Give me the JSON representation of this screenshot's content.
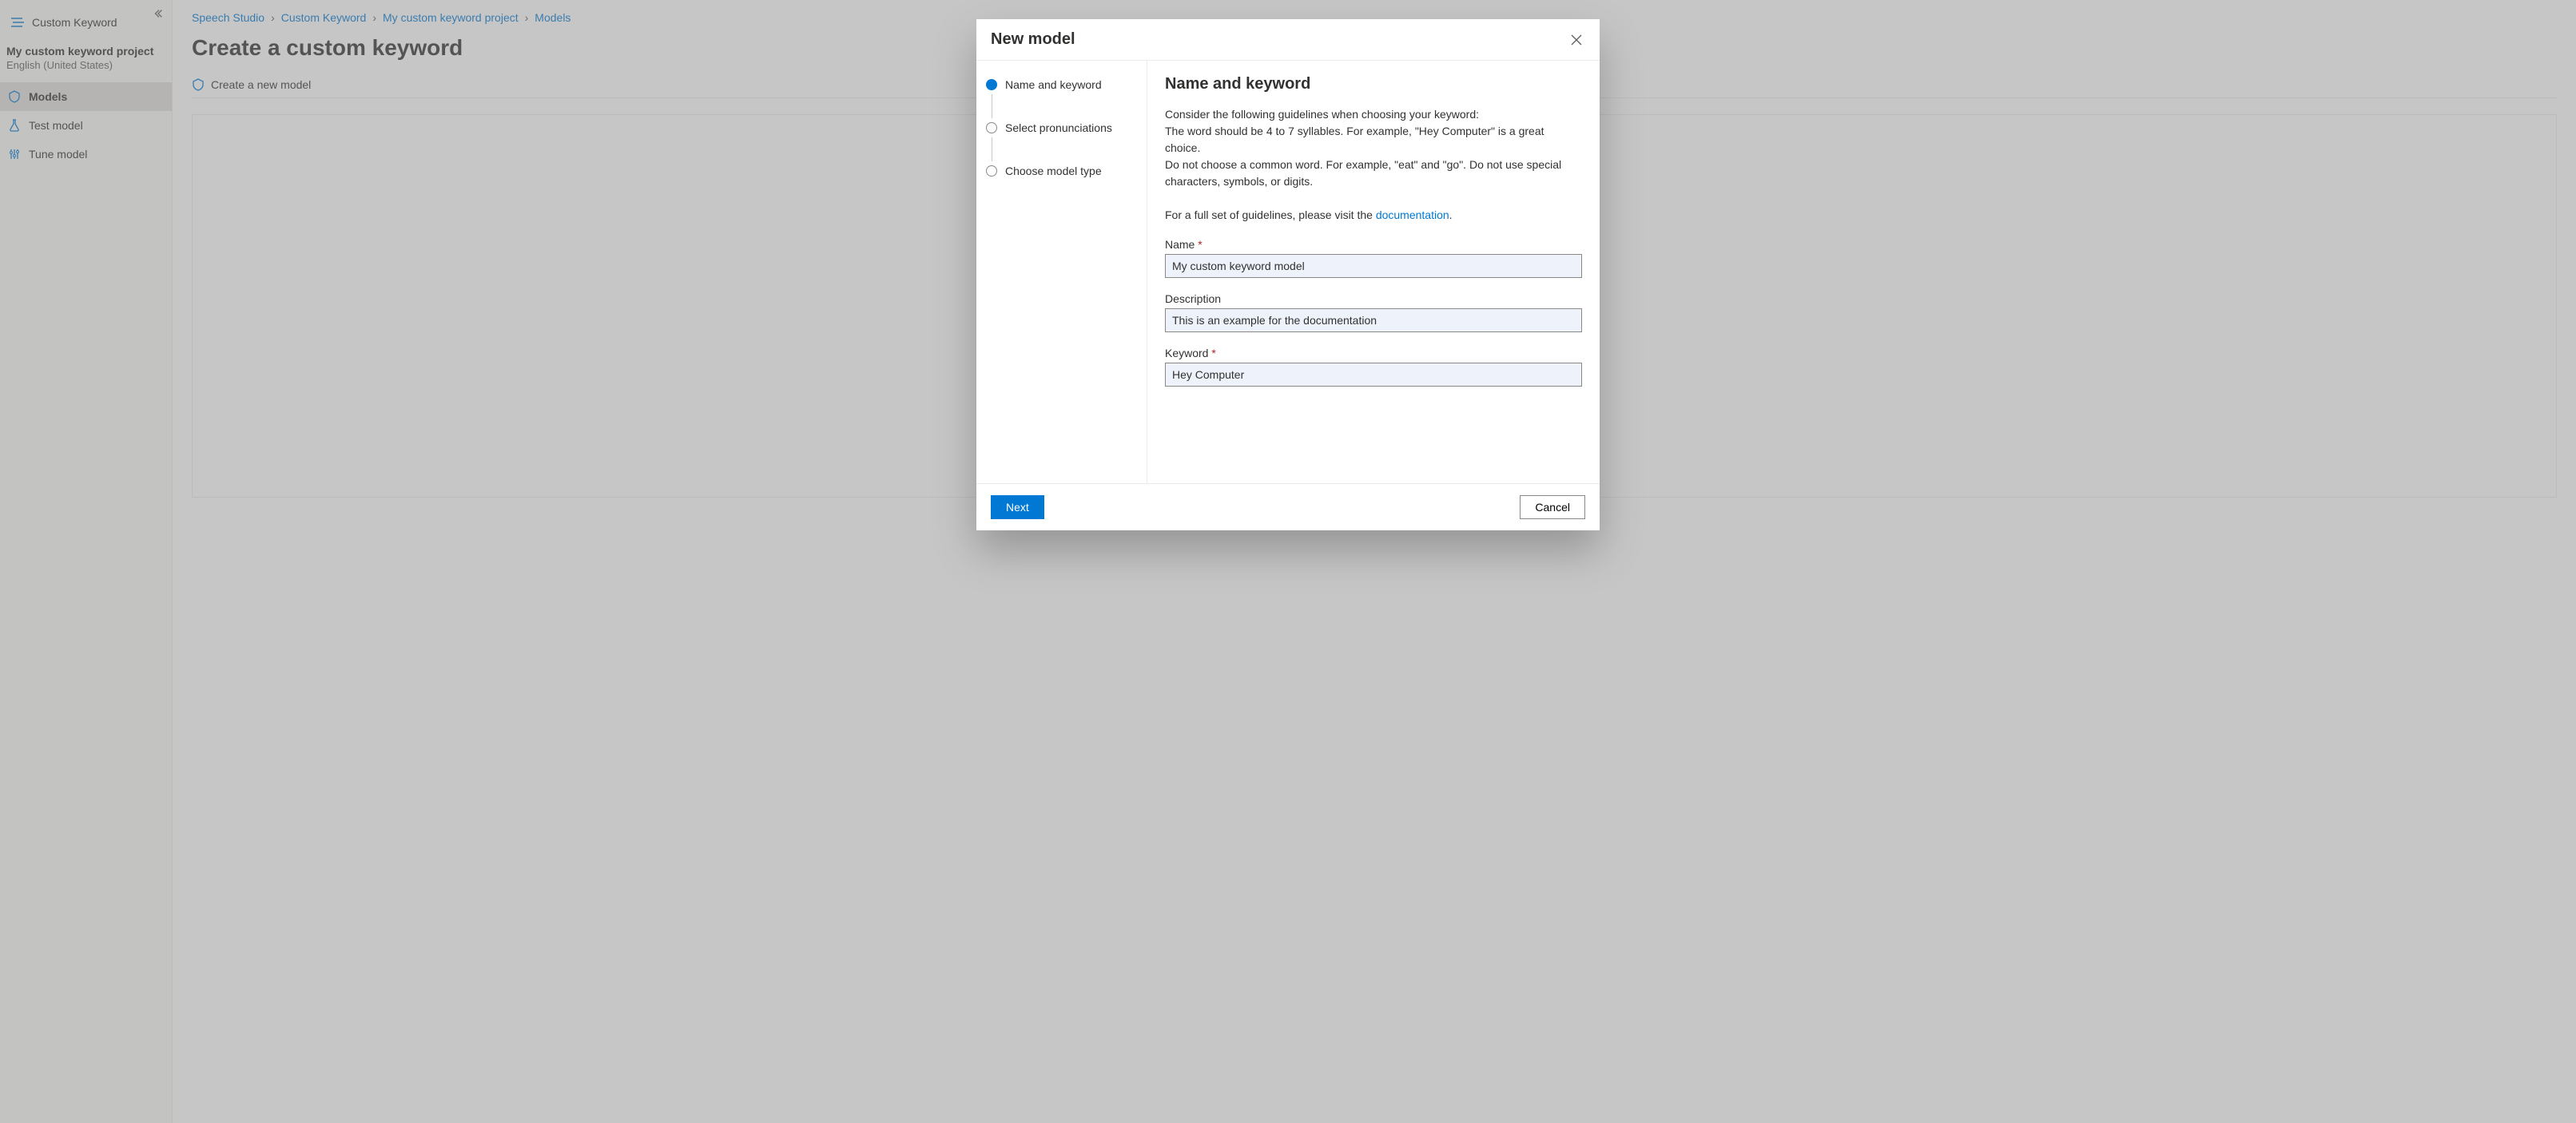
{
  "sidebar": {
    "app_name": "Custom Keyword",
    "project_name": "My custom keyword project",
    "locale": "English (United States)",
    "items": [
      {
        "label": "Models"
      },
      {
        "label": "Test model"
      },
      {
        "label": "Tune model"
      }
    ]
  },
  "breadcrumbs": [
    "Speech Studio",
    "Custom Keyword",
    "My custom keyword project",
    "Models"
  ],
  "page": {
    "title": "Create a custom keyword",
    "toolbar_create": "Create a new model"
  },
  "modal": {
    "title": "New model",
    "steps": [
      "Name and keyword",
      "Select pronunciations",
      "Choose model type"
    ],
    "panel_heading": "Name and keyword",
    "guide_intro": "Consider the following guidelines when choosing your keyword:",
    "guide_line1": "The word should be 4 to 7 syllables. For example, \"Hey Computer\" is a great choice.",
    "guide_line2": "Do not choose a common word. For example, \"eat\" and \"go\". Do not use special characters, symbols, or digits.",
    "guide_doc_prefix": "For a full set of guidelines, please visit the ",
    "guide_doc_link": "documentation",
    "name_label": "Name",
    "name_value": "My custom keyword model",
    "desc_label": "Description",
    "desc_value": "This is an example for the documentation",
    "keyword_label": "Keyword",
    "keyword_value": "Hey Computer",
    "next": "Next",
    "cancel": "Cancel"
  }
}
